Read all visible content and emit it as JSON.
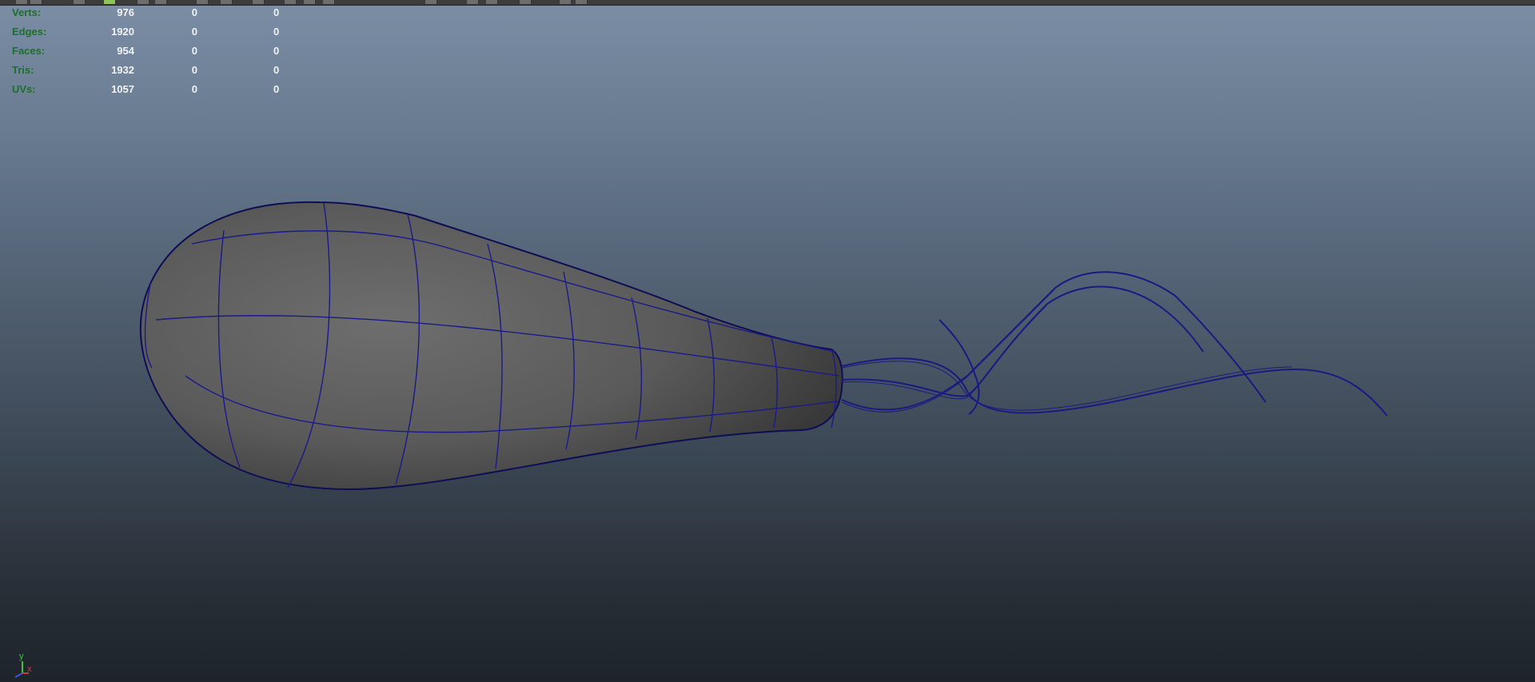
{
  "hud": {
    "rows": [
      {
        "label": "Verts:",
        "total": "976",
        "selected": "0",
        "comp": "0"
      },
      {
        "label": "Edges:",
        "total": "1920",
        "selected": "0",
        "comp": "0"
      },
      {
        "label": "Faces:",
        "total": "954",
        "selected": "0",
        "comp": "0"
      },
      {
        "label": "Tris:",
        "total": "1932",
        "selected": "0",
        "comp": "0"
      },
      {
        "label": "UVs:",
        "total": "1057",
        "selected": "0",
        "comp": "0"
      }
    ]
  },
  "axis": {
    "y": "y",
    "x": "x"
  },
  "colors": {
    "label_green": "#1d6e2c",
    "wire_blue": "#1a1a80",
    "axis_y": "#46c043",
    "axis_x": "#d23a3a",
    "axis_z": "#3b56d6"
  },
  "icons": [
    "toolbar-button-icon",
    "view-axis-icon"
  ]
}
